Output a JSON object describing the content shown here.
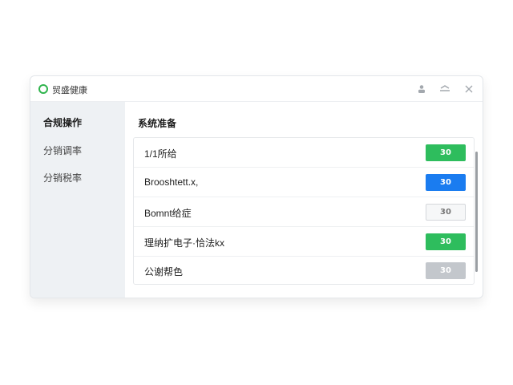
{
  "window": {
    "title": "贸盛健康",
    "controls": {
      "user_icon": "user-icon",
      "minimize_icon": "minimize-icon",
      "close_icon": "close-icon"
    }
  },
  "sidebar": {
    "items": [
      {
        "label": "合规操作",
        "active": true
      },
      {
        "label": "分销调率",
        "active": false
      },
      {
        "label": "分销税率",
        "active": false
      }
    ]
  },
  "main": {
    "title": "系统准备",
    "rows": [
      {
        "label": "1/1所给",
        "button": "30",
        "style": "green"
      },
      {
        "label": "Brooshtett.x,",
        "button": "30",
        "style": "blue"
      },
      {
        "label": "Bomnt给症",
        "button": "30",
        "style": "outline"
      },
      {
        "label": "理纳扩电子·恰法kx",
        "button": "30",
        "style": "green"
      },
      {
        "label": "公谢帮色",
        "button": "30",
        "style": "gray"
      }
    ]
  },
  "colors": {
    "green": "#2ebd5d",
    "blue": "#1a7cf0",
    "gray": "#c3c7cc",
    "outline_bg": "#f6f7f8",
    "outline_border": "#d4d7db",
    "outline_text": "#777777",
    "sidebar_bg": "#eef1f4",
    "app_icon": "#2fb44d"
  }
}
